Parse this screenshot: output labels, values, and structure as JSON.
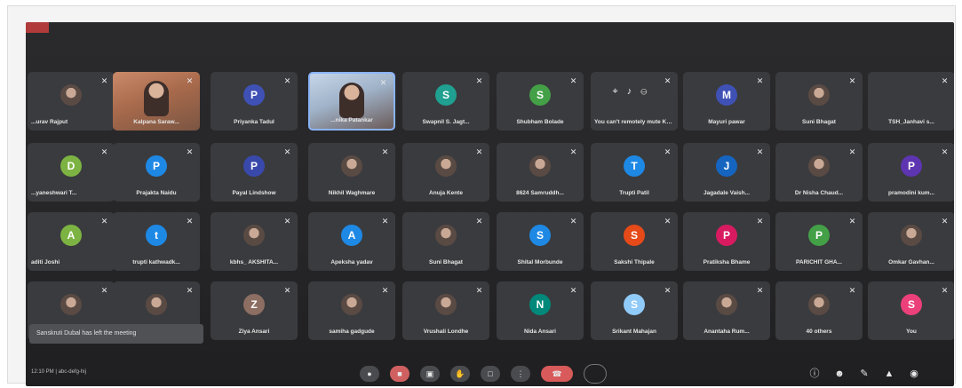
{
  "tiles": [
    {
      "name": "...urav Rajput",
      "avatar": "photo",
      "kind": "avatar"
    },
    {
      "name": "Kalpana Saraw...",
      "avatar": "",
      "kind": "video"
    },
    {
      "name": "Priyanka Tadul",
      "avatar": "P",
      "color": "#3f51b5",
      "kind": "avatar"
    },
    {
      "name": "...nika Patankar",
      "avatar": "",
      "kind": "video2",
      "active": true
    },
    {
      "name": "Swapnil S. Jagt...",
      "avatar": "S",
      "color": "#20a090",
      "kind": "avatar"
    },
    {
      "name": "Shubham Bolade",
      "avatar": "S",
      "color": "#43a047",
      "kind": "avatar"
    },
    {
      "name": "You can't remotely mute Kristi...",
      "avatar": "",
      "kind": "controls"
    },
    {
      "name": "Mayuri pawar",
      "avatar": "M",
      "color": "#3f51b5",
      "kind": "avatar"
    },
    {
      "name": "Suni Bhagat",
      "avatar": "photo",
      "kind": "avatar"
    },
    {
      "name": "TSH_Janhavi s...",
      "avatar": "",
      "kind": "blank"
    },
    {
      "name": "...yaneshwari T...",
      "avatar": "D",
      "color": "#7cb342",
      "kind": "avatar"
    },
    {
      "name": "Prajakta Naidu",
      "avatar": "P",
      "color": "#1e88e5",
      "kind": "avatar"
    },
    {
      "name": "Payal Lindshow",
      "avatar": "P",
      "color": "#3949ab",
      "kind": "avatar"
    },
    {
      "name": "Nikhil Waghmare",
      "avatar": "photo",
      "kind": "avatar"
    },
    {
      "name": "Anuja Kente",
      "avatar": "photo",
      "kind": "avatar"
    },
    {
      "name": "8624 Samruddh...",
      "avatar": "photo",
      "kind": "avatar"
    },
    {
      "name": "Trupti Patil",
      "avatar": "T",
      "color": "#1e88e5",
      "kind": "avatar"
    },
    {
      "name": "Jagadale Vaish...",
      "avatar": "J",
      "color": "#1565c0",
      "kind": "avatar"
    },
    {
      "name": "Dr Nisha Chaud...",
      "avatar": "photo",
      "kind": "avatar"
    },
    {
      "name": "pramodini kum...",
      "avatar": "P",
      "color": "#5e35b1",
      "kind": "avatar"
    },
    {
      "name": "aditi Joshi",
      "avatar": "A",
      "color": "#7cb342",
      "kind": "avatar"
    },
    {
      "name": "trupti kathwadk...",
      "avatar": "t",
      "color": "#1e88e5",
      "kind": "avatar"
    },
    {
      "name": "kbhs_ AKSHITA...",
      "avatar": "photo",
      "kind": "avatar"
    },
    {
      "name": "Apeksha yadav",
      "avatar": "A",
      "color": "#1e88e5",
      "kind": "avatar"
    },
    {
      "name": "Suni Bhagat",
      "avatar": "photo",
      "kind": "avatar"
    },
    {
      "name": "Shital Morbunde",
      "avatar": "S",
      "color": "#1e88e5",
      "kind": "avatar"
    },
    {
      "name": "Sakshi Thipale",
      "avatar": "S",
      "color": "#e64a19",
      "kind": "avatar"
    },
    {
      "name": "Pratiksha Bhame",
      "avatar": "P",
      "color": "#d81b60",
      "kind": "avatar"
    },
    {
      "name": "PARICHIT GHA...",
      "avatar": "P",
      "color": "#43a047",
      "kind": "avatar"
    },
    {
      "name": "Omkar Gavhan...",
      "avatar": "photo",
      "kind": "avatar"
    },
    {
      "name": "",
      "avatar": "photo",
      "kind": "avatar"
    },
    {
      "name": "",
      "avatar": "photo",
      "kind": "avatar"
    },
    {
      "name": "Ziya Ansari",
      "avatar": "Z",
      "color": "#8d6e63",
      "kind": "avatar"
    },
    {
      "name": "samiha gadgude",
      "avatar": "photo",
      "kind": "avatar"
    },
    {
      "name": "Vrushali Londhe",
      "avatar": "photo",
      "kind": "avatar"
    },
    {
      "name": "Nida Ansari",
      "avatar": "N",
      "color": "#00897b",
      "kind": "avatar"
    },
    {
      "name": "Srikant Mahajan",
      "avatar": "S",
      "color": "#90caf9",
      "kind": "avatar"
    },
    {
      "name": "Anantaha Rum...",
      "avatar": "photo",
      "kind": "avatar"
    },
    {
      "name": "40 others",
      "avatar": "photo",
      "kind": "avatar"
    },
    {
      "name": "You",
      "avatar": "S",
      "color": "#ec407a",
      "kind": "avatar"
    }
  ],
  "toast": {
    "text": "Sanskruti Dubal has left the meeting"
  },
  "toolbar": {
    "meeting_code": "12:10 PM | abc-defg-hij",
    "buttons": [
      "mic",
      "cam",
      "cc",
      "hand",
      "present",
      "more",
      "end",
      "circle"
    ],
    "right_icons": [
      "info-icon",
      "people-icon",
      "chat-icon",
      "activities-icon",
      "lock-icon"
    ]
  },
  "colors": {
    "background": "#262628",
    "tile": "#3a3b3e",
    "accent": "#8ab4f8",
    "end_call": "#d85a5a"
  }
}
